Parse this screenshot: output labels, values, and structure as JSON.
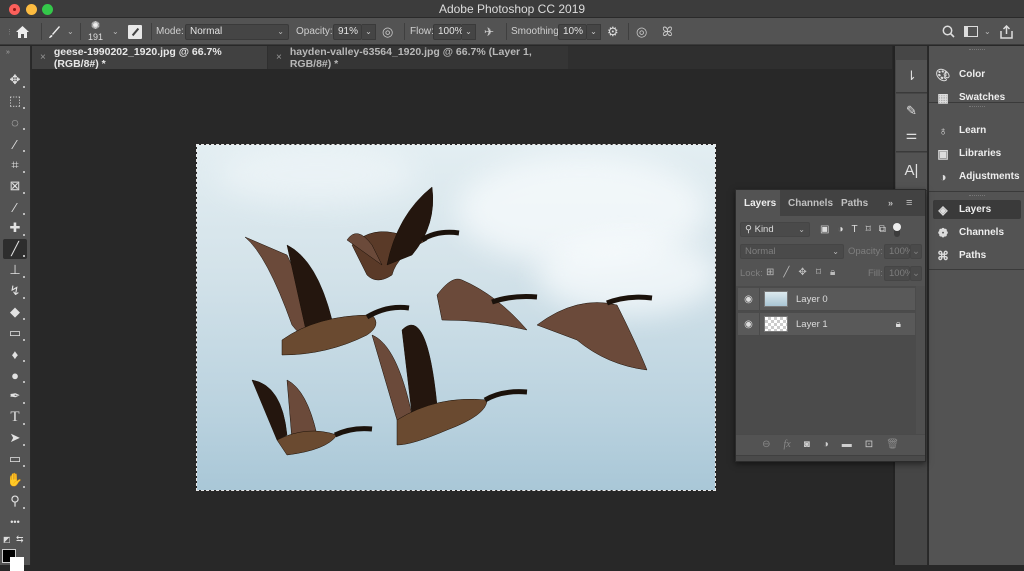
{
  "window": {
    "title": "Adobe Photoshop CC 2019"
  },
  "options_bar": {
    "brush_size": "191",
    "mode_label": "Mode:",
    "mode_value": "Normal",
    "opacity_label": "Opacity:",
    "opacity_value": "91%",
    "flow_label": "Flow:",
    "flow_value": "100%",
    "smoothing_label": "Smoothing:",
    "smoothing_value": "10%",
    "icons": [
      "home-icon",
      "brush-tool-icon",
      "brush-preset-icon",
      "brush-settings-icon",
      "pressure-opacity-icon",
      "airbrush-icon",
      "settings-gear-icon",
      "pressure-size-icon",
      "symmetry-butterfly-icon",
      "search-icon",
      "workspace-icon",
      "share-icon"
    ]
  },
  "document_tabs": [
    {
      "label": "geese-1990202_1920.jpg @ 66.7% (RGB/8#) *",
      "active": true
    },
    {
      "label": "hayden-valley-63564_1920.jpg @ 66.7% (Layer 1, RGB/8#) *",
      "active": false
    }
  ],
  "toolbar": {
    "tools": [
      {
        "name": "move-tool",
        "glyph": "✥"
      },
      {
        "name": "marquee-tool",
        "glyph": "⬚"
      },
      {
        "name": "lasso-tool",
        "glyph": "◌"
      },
      {
        "name": "magic-wand-tool",
        "glyph": "⁄"
      },
      {
        "name": "crop-tool",
        "glyph": "⌗"
      },
      {
        "name": "frame-tool",
        "glyph": "⊠"
      },
      {
        "name": "eyedropper-tool",
        "glyph": "⁄"
      },
      {
        "name": "healing-brush-tool",
        "glyph": "✚"
      },
      {
        "name": "brush-tool",
        "glyph": "╱",
        "selected": true
      },
      {
        "name": "clone-stamp-tool",
        "glyph": "⊥"
      },
      {
        "name": "history-brush-tool",
        "glyph": "↯"
      },
      {
        "name": "eraser-tool",
        "glyph": "◆"
      },
      {
        "name": "gradient-tool",
        "glyph": "▭"
      },
      {
        "name": "blur-tool",
        "glyph": "♦"
      },
      {
        "name": "dodge-tool",
        "glyph": "●"
      },
      {
        "name": "pen-tool",
        "glyph": "✒"
      },
      {
        "name": "type-tool",
        "glyph": "T"
      },
      {
        "name": "path-selection-tool",
        "glyph": "➤"
      },
      {
        "name": "rectangle-tool",
        "glyph": "▭"
      },
      {
        "name": "hand-tool",
        "glyph": "✋"
      },
      {
        "name": "zoom-tool",
        "glyph": "⚲"
      },
      {
        "name": "edit-toolbar",
        "glyph": "•••"
      }
    ],
    "foreground_color": "#000000",
    "background_color": "#ffffff"
  },
  "right_dock": {
    "groups": [
      [
        {
          "label": "Color",
          "icon": "palette-icon"
        },
        {
          "label": "Swatches",
          "icon": "grid-icon"
        }
      ],
      [
        {
          "label": "Learn",
          "icon": "lightbulb-icon"
        },
        {
          "label": "Libraries",
          "icon": "libraries-icon"
        },
        {
          "label": "Adjustments",
          "icon": "adjustments-icon"
        }
      ],
      [
        {
          "label": "Layers",
          "icon": "layers-icon",
          "selected": true
        },
        {
          "label": "Channels",
          "icon": "channels-icon"
        },
        {
          "label": "Paths",
          "icon": "paths-icon"
        }
      ]
    ]
  },
  "layers_panel": {
    "tabs": [
      "Layers",
      "Channels",
      "Paths"
    ],
    "filter_kind": "Kind",
    "blend_mode": "Normal",
    "opacity_label": "Opacity:",
    "opacity_value": "100%",
    "lock_label": "Lock:",
    "fill_label": "Fill:",
    "fill_value": "100%",
    "layers": [
      {
        "name": "Layer 0",
        "visible": true,
        "locked": false,
        "thumb": "photo"
      },
      {
        "name": "Layer 1",
        "visible": true,
        "locked": true,
        "thumb": "transparent"
      }
    ]
  },
  "colors": {
    "app_bg": "#282828",
    "panel_bg": "#535353",
    "selected_tool_bg": "#2e2e2e"
  }
}
